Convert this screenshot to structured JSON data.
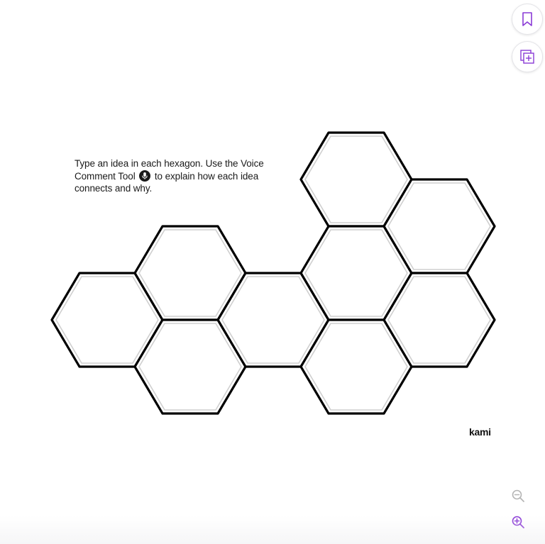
{
  "instructions": {
    "before_icon": "Type an idea in each hexagon. Use the Voice Comment Tool",
    "after_icon": "to explain how each idea connects and why."
  },
  "brand": {
    "label": "kami"
  },
  "toolbar": {
    "bookmark_icon": "bookmark-icon",
    "add_page_icon": "add-page-icon",
    "zoom_out_icon": "zoom-out-icon",
    "zoom_in_icon": "zoom-in-icon",
    "zoom_out_enabled": false
  },
  "colors": {
    "hex_outer": "#000000",
    "hex_inner": "#cfcfcf",
    "accent": "#8a3bd6",
    "disabled": "#b5b5b5"
  },
  "hexagons": [
    {
      "id": "hex-1"
    },
    {
      "id": "hex-2"
    },
    {
      "id": "hex-3"
    },
    {
      "id": "hex-4"
    },
    {
      "id": "hex-5"
    },
    {
      "id": "hex-6"
    },
    {
      "id": "hex-7"
    },
    {
      "id": "hex-8"
    },
    {
      "id": "hex-9"
    }
  ]
}
